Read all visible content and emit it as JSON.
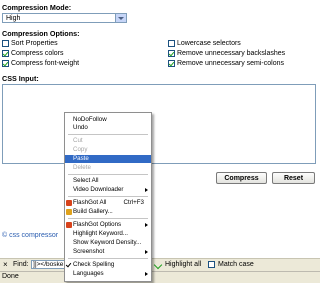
{
  "form": {
    "compression_mode_label": "Compression Mode:",
    "compression_mode_value": "High",
    "compression_options_label": "Compression Options:",
    "options": [
      {
        "label": "Sort Properties",
        "checked": false
      },
      {
        "label": "Lowercase selectors",
        "checked": false
      },
      {
        "label": "Compress colors",
        "checked": true
      },
      {
        "label": "Remove unnecessary backslashes",
        "checked": true
      },
      {
        "label": "Compress font-weight",
        "checked": true
      },
      {
        "label": "Remove unnecessary semi-colons",
        "checked": true
      }
    ],
    "css_input_label": "CSS Input:",
    "css_input_value": "",
    "compress_button": "Compress",
    "reset_button": "Reset",
    "footer_link": "© css compressor"
  },
  "findbar": {
    "close_glyph": "×",
    "find_label": "Find:",
    "find_value": "]]></boske",
    "highlight_all": "Highlight all",
    "match_case": "Match case"
  },
  "status": {
    "text": "Done"
  },
  "context_menu": {
    "items": [
      {
        "label": "NoDoFollow",
        "state": "normal"
      },
      {
        "label": "Undo",
        "state": "normal"
      },
      {
        "label": "Cut",
        "state": "disabled"
      },
      {
        "label": "Copy",
        "state": "disabled"
      },
      {
        "label": "Paste",
        "state": "selected"
      },
      {
        "label": "Delete",
        "state": "disabled"
      },
      {
        "label": "Select All",
        "state": "normal"
      },
      {
        "label": "Video Downloader",
        "state": "normal",
        "submenu": true
      },
      {
        "label": "FlashGot All",
        "shortcut": "Ctrl+F3",
        "state": "normal",
        "icon": "flashgot-icon"
      },
      {
        "label": "Build Gallery...",
        "state": "normal",
        "icon": "gallery-icon"
      },
      {
        "label": "FlashGot Options",
        "state": "normal",
        "submenu": true,
        "icon": "flashgot-icon"
      },
      {
        "label": "Highlight Keyword...",
        "state": "normal"
      },
      {
        "label": "Show Keyword Density...",
        "state": "normal"
      },
      {
        "label": "Screenshot",
        "state": "normal",
        "submenu": true
      },
      {
        "label": "Check Spelling",
        "state": "checked"
      },
      {
        "label": "Languages",
        "state": "normal",
        "submenu": true
      }
    ]
  },
  "colors": {
    "accent": "#316ac5",
    "link": "#2a5db0",
    "chrome": "#ece9d8"
  }
}
